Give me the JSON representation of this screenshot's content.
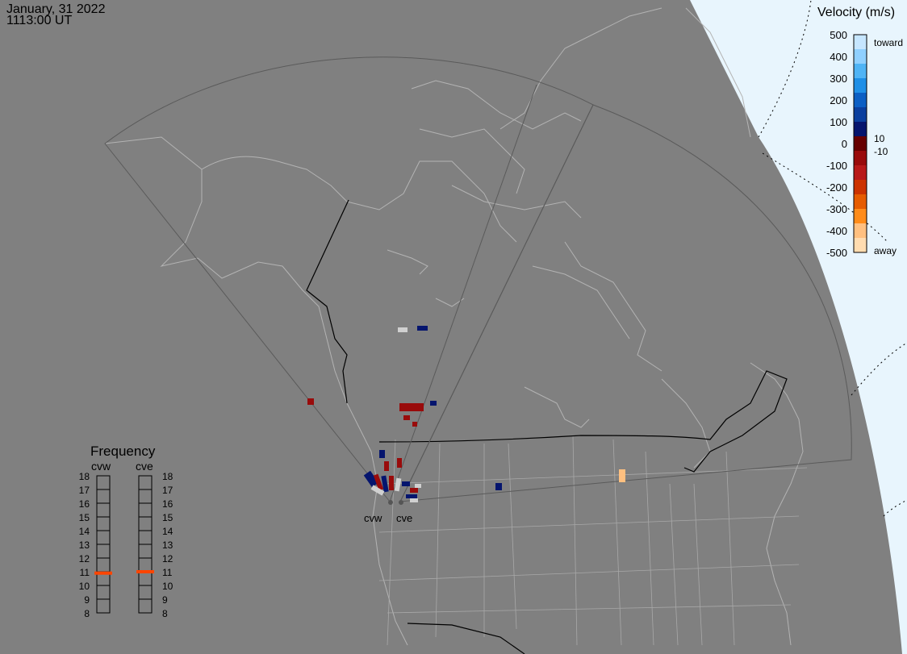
{
  "header": {
    "date": "January, 31 2022",
    "time": "1113:00 UT"
  },
  "velocity_scale": {
    "title": "Velocity (m/s)",
    "ticks": [
      "500",
      "400",
      "300",
      "200",
      "100",
      "0",
      "-100",
      "-200",
      "-300",
      "-400",
      "-500"
    ],
    "toward_label": "toward",
    "away_label": "away",
    "pos_threshold": "10",
    "neg_threshold": "-10",
    "colors": [
      "#c6e6ff",
      "#8fd0ff",
      "#4fb4f5",
      "#1e8fe6",
      "#0b5fc4",
      "#0a3f9e",
      "#05156e",
      "#660000",
      "#990b0b",
      "#b81919",
      "#cc3300",
      "#e65c00",
      "#ff8c1a",
      "#ffc080",
      "#ffdcb0"
    ]
  },
  "radars": [
    {
      "code": "cvw",
      "label": "cvw"
    },
    {
      "code": "cve",
      "label": "cve"
    }
  ],
  "frequency_panel": {
    "title": "Frequency",
    "columns": [
      "cvw",
      "cve"
    ],
    "ticks": [
      "18",
      "17",
      "16",
      "15",
      "14",
      "13",
      "12",
      "11",
      "10",
      "9",
      "8"
    ],
    "range_mhz": [
      8,
      18
    ],
    "cvw_mhz": 10.9,
    "cve_mhz": 11.0,
    "marker_color": "#ff4500"
  }
}
